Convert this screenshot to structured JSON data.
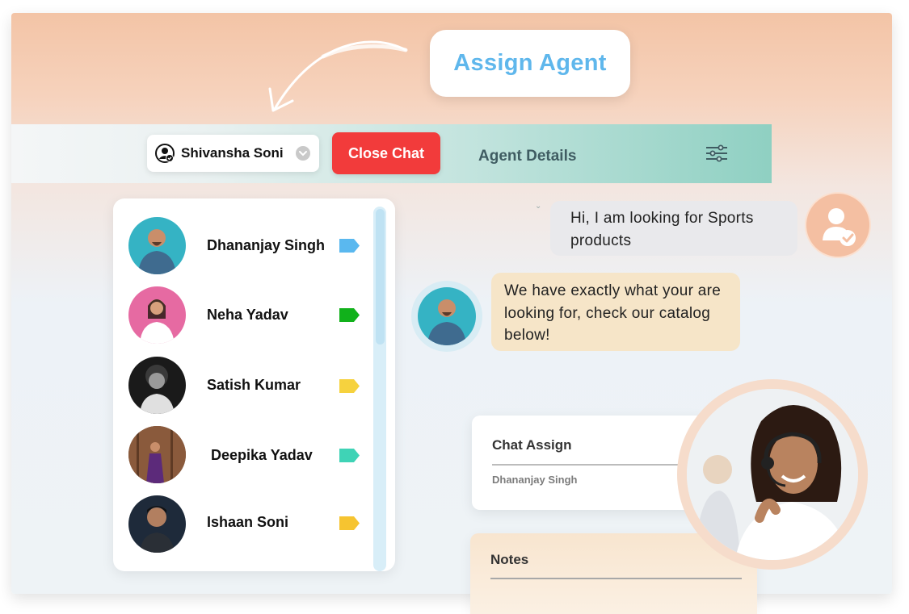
{
  "banner": {
    "label": "Assign Agent"
  },
  "topbar": {
    "agent_name": "Shivansha Soni",
    "close_label": "Close Chat",
    "details_label": "Agent Details"
  },
  "contacts": [
    {
      "name": "Dhananjay Singh",
      "tag_color": "#5ab8ef"
    },
    {
      "name": "Neha Yadav",
      "tag_color": "#11b11b"
    },
    {
      "name": "Satish Kumar",
      "tag_color": "#f6d23e"
    },
    {
      "name": "Deepika Yadav",
      "tag_color": "#3fd3b6"
    },
    {
      "name": "Ishaan Soni",
      "tag_color": "#f6c430"
    }
  ],
  "messages": {
    "user": "Hi, I am looking for Sports products",
    "agent": "We have exactly what your are looking for, check our catalog below!"
  },
  "chat_assign": {
    "title": "Chat Assign",
    "value": "Dhananjay Singh"
  },
  "notes": {
    "title": "Notes"
  },
  "colors": {
    "accent": "#5fb7ec",
    "close": "#f23b3b",
    "teal": "#8fd0c2",
    "peach": "#f3c4a6"
  }
}
